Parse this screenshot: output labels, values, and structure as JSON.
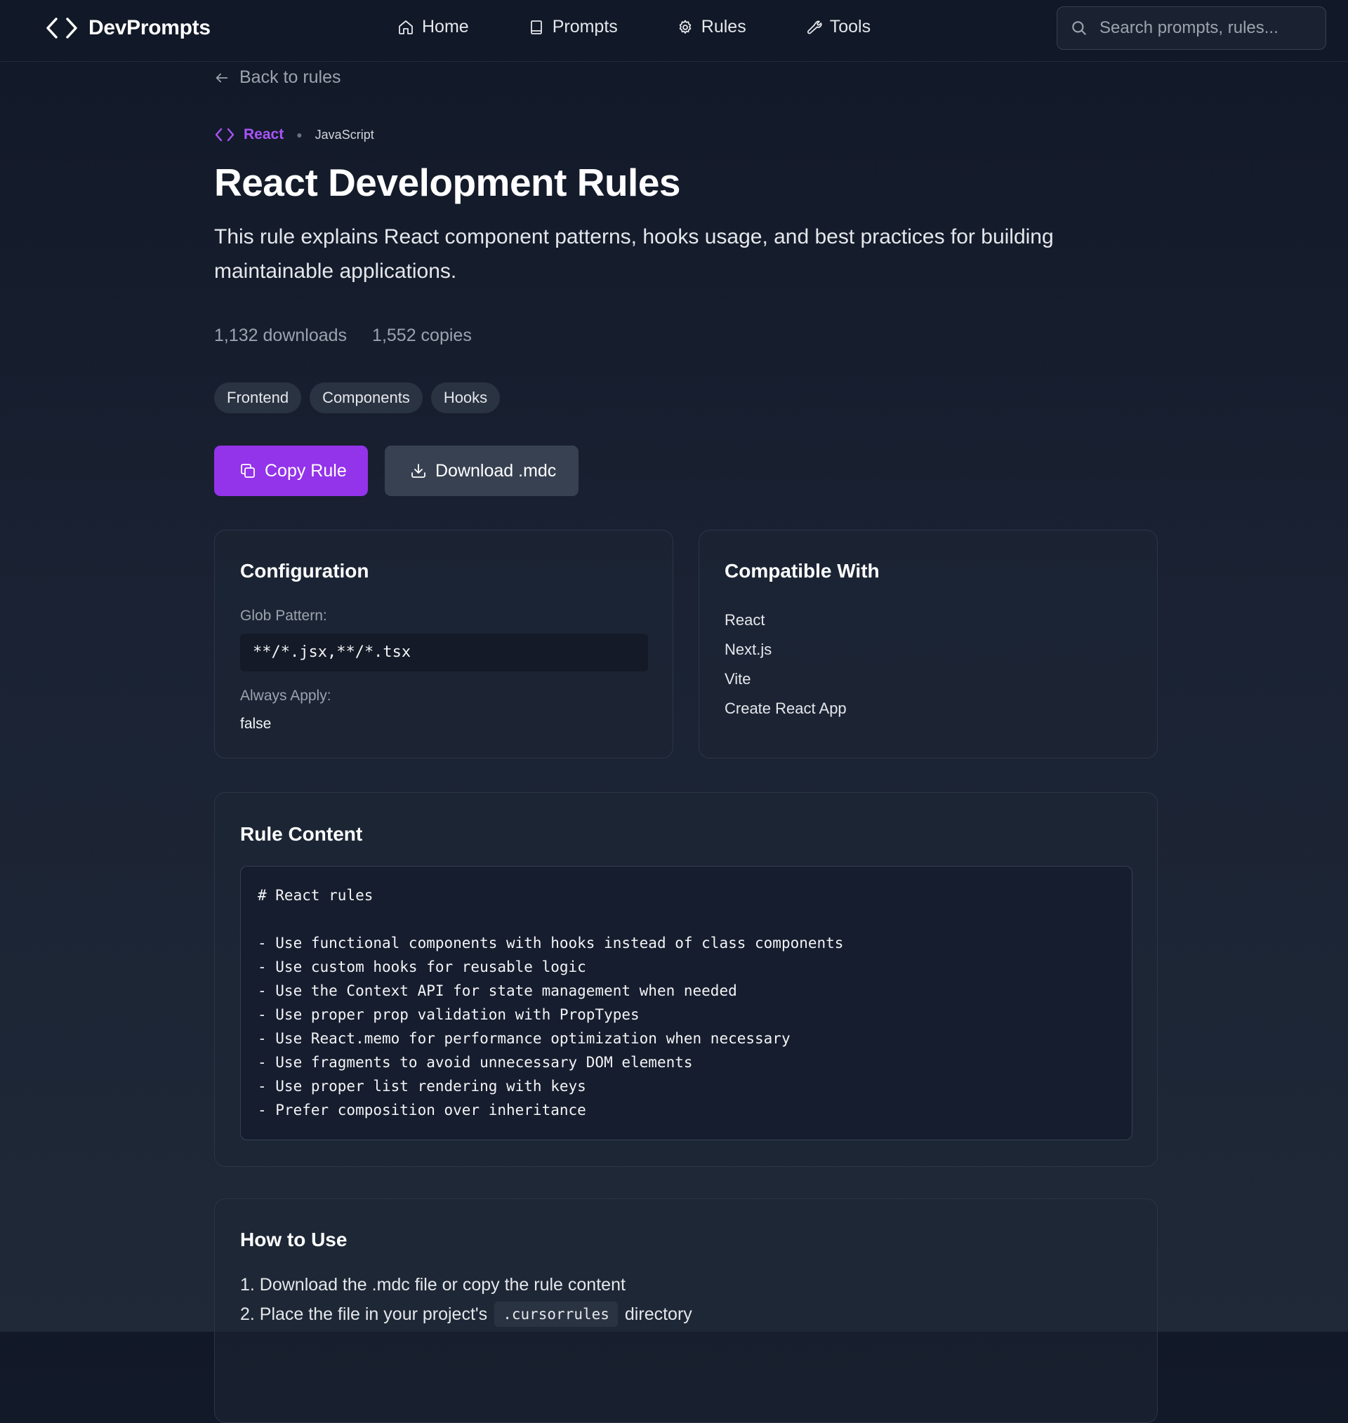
{
  "nav": {
    "brand": "DevPrompts",
    "links": [
      {
        "label": "Home",
        "icon": "home-icon"
      },
      {
        "label": "Prompts",
        "icon": "book-icon"
      },
      {
        "label": "Rules",
        "icon": "gear-icon"
      },
      {
        "label": "Tools",
        "icon": "wrench-icon"
      }
    ],
    "search_placeholder": "Search prompts, rules..."
  },
  "page": {
    "back_label": "Back to rules",
    "category": "React",
    "language": "JavaScript",
    "title": "React Development Rules",
    "description": "This rule explains React component patterns, hooks usage, and best practices for building maintainable applications.",
    "downloads": "1,132 downloads",
    "copies": "1,552 copies",
    "tags": [
      "Frontend",
      "Components",
      "Hooks"
    ],
    "copy_button": "Copy Rule",
    "download_button": "Download .mdc"
  },
  "configuration": {
    "title": "Configuration",
    "glob_label": "Glob Pattern:",
    "glob_value": "**/*.jsx,**/*.tsx",
    "always_apply_label": "Always Apply:",
    "always_apply_value": "false"
  },
  "compatible": {
    "title": "Compatible With",
    "items": [
      "React",
      "Next.js",
      "Vite",
      "Create React App"
    ]
  },
  "rule_content": {
    "title": "Rule Content",
    "code": "# React rules\n\n- Use functional components with hooks instead of class components\n- Use custom hooks for reusable logic\n- Use the Context API for state management when needed\n- Use proper prop validation with PropTypes\n- Use React.memo for performance optimization when necessary\n- Use fragments to avoid unnecessary DOM elements\n- Use proper list rendering with keys\n- Prefer composition over inheritance"
  },
  "how_to_use": {
    "title": "How to Use",
    "step1": "1. Download the .mdc file or copy the rule content",
    "step2_prefix": "2. Place the file in your project's",
    "step2_code": ".cursorrules",
    "step2_suffix": "directory"
  },
  "colors": {
    "accent": "#9333ea",
    "accent_text": "#a855f7",
    "background": "#111827",
    "secondary_button": "#374151"
  }
}
